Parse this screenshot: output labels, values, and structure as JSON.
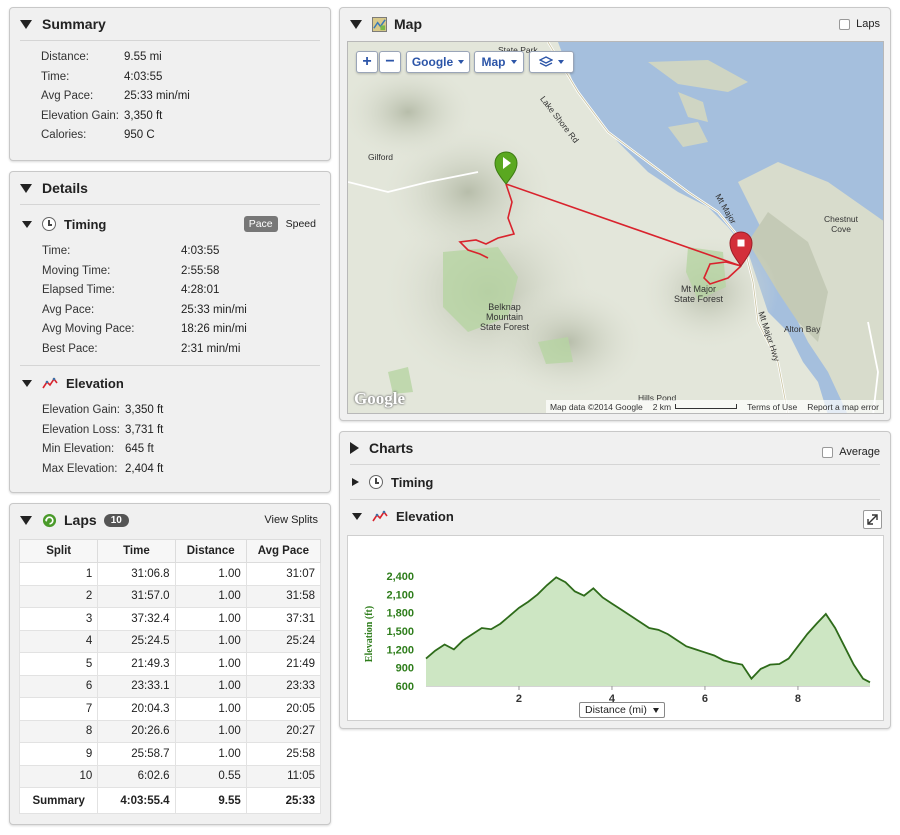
{
  "summary": {
    "title": "Summary",
    "rows": [
      {
        "label": "Distance:",
        "value": "9.55 mi"
      },
      {
        "label": "Time:",
        "value": "4:03:55"
      },
      {
        "label": "Avg Pace:",
        "value": "25:33 min/mi"
      },
      {
        "label": "Elevation Gain:",
        "value": "3,350 ft"
      },
      {
        "label": "Calories:",
        "value": "950 C"
      }
    ]
  },
  "details": {
    "title": "Details",
    "timing": {
      "title": "Timing",
      "toggle_on": "Pace",
      "toggle_off": "Speed",
      "rows": [
        {
          "label": "Time:",
          "value": "4:03:55"
        },
        {
          "label": "Moving Time:",
          "value": "2:55:58"
        },
        {
          "label": "Elapsed Time:",
          "value": "4:28:01"
        },
        {
          "label": "Avg Pace:",
          "value": "25:33 min/mi"
        },
        {
          "label": "Avg Moving Pace:",
          "value": "18:26 min/mi"
        },
        {
          "label": "Best Pace:",
          "value": "2:31 min/mi"
        }
      ]
    },
    "elevation": {
      "title": "Elevation",
      "rows": [
        {
          "label": "Elevation Gain:",
          "value": "3,350 ft"
        },
        {
          "label": "Elevation Loss:",
          "value": "3,731 ft"
        },
        {
          "label": "Min Elevation:",
          "value": "645 ft"
        },
        {
          "label": "Max Elevation:",
          "value": "2,404 ft"
        }
      ]
    }
  },
  "laps": {
    "title": "Laps",
    "count": "10",
    "view_splits": "View Splits",
    "columns": [
      "Split",
      "Time",
      "Distance",
      "Avg Pace"
    ],
    "rows": [
      [
        "1",
        "31:06.8",
        "1.00",
        "31:07"
      ],
      [
        "2",
        "31:57.0",
        "1.00",
        "31:58"
      ],
      [
        "3",
        "37:32.4",
        "1.00",
        "37:31"
      ],
      [
        "4",
        "25:24.5",
        "1.00",
        "25:24"
      ],
      [
        "5",
        "21:49.3",
        "1.00",
        "21:49"
      ],
      [
        "6",
        "23:33.1",
        "1.00",
        "23:33"
      ],
      [
        "7",
        "20:04.3",
        "1.00",
        "20:05"
      ],
      [
        "8",
        "20:26.6",
        "1.00",
        "20:27"
      ],
      [
        "9",
        "25:58.7",
        "1.00",
        "25:58"
      ],
      [
        "10",
        "6:02.6",
        "0.55",
        "11:05"
      ]
    ],
    "summary_row": [
      "Summary",
      "4:03:55.4",
      "9.55",
      "25:33"
    ]
  },
  "map": {
    "title": "Map",
    "laps_label": "Laps",
    "zoom_in": "+",
    "zoom_out": "−",
    "provider_btn": "Google",
    "type_btn": "Map",
    "labels": {
      "state_park": "State Park",
      "lake_shore": "Lake Shore Rd",
      "gilford": "Gilford",
      "mt_major_rd": "Mt Major",
      "chestnut": "Chestnut\nCove",
      "mt_major_sf": "Mt Major\nState Forest",
      "belknap": "Belknap\nMountain\nState Forest",
      "alton_bay": "Alton Bay",
      "mt_major_hwy": "Mt Major Hwy",
      "hills_pond": "Hills Pond"
    },
    "logo": "Google",
    "attribution": "Map data ©2014 Google",
    "scale": "2 km",
    "terms": "Terms of Use",
    "report": "Report a map error",
    "colors": {
      "water": "#a5bfdd",
      "land": "#e3e6da",
      "route": "#d9232d",
      "start": "#5aa820",
      "end": "#d32f3a"
    }
  },
  "charts": {
    "title": "Charts",
    "average_label": "Average",
    "timing_label": "Timing",
    "elevation_label": "Elevation",
    "x_selector": "Distance (mi)"
  },
  "chart_data": {
    "type": "area",
    "ylabel": "Elevation (ft)",
    "xlabel": "Distance (mi)",
    "xlim": [
      0,
      9.55
    ],
    "ylim": [
      600,
      2500
    ],
    "xticks": [
      2,
      4,
      6,
      8
    ],
    "yticks": [
      600,
      900,
      1200,
      1500,
      1800,
      2100,
      2400
    ],
    "ytick_labels": [
      "600",
      "900",
      "1,200",
      "1,500",
      "1,800",
      "2,100",
      "2,400"
    ],
    "x": [
      0,
      0.2,
      0.4,
      0.6,
      0.8,
      1.0,
      1.2,
      1.4,
      1.6,
      1.8,
      2.0,
      2.2,
      2.4,
      2.6,
      2.8,
      3.0,
      3.2,
      3.4,
      3.6,
      3.8,
      4.0,
      4.2,
      4.4,
      4.6,
      4.8,
      5.0,
      5.2,
      5.4,
      5.6,
      5.8,
      6.0,
      6.2,
      6.4,
      6.6,
      6.8,
      7.0,
      7.2,
      7.4,
      7.6,
      7.8,
      8.0,
      8.2,
      8.4,
      8.6,
      8.8,
      9.0,
      9.2,
      9.4,
      9.55
    ],
    "y": [
      1050,
      1180,
      1280,
      1200,
      1350,
      1450,
      1550,
      1530,
      1620,
      1750,
      1880,
      1980,
      2100,
      2250,
      2380,
      2300,
      2150,
      2080,
      2200,
      2050,
      1950,
      1850,
      1750,
      1650,
      1550,
      1520,
      1450,
      1350,
      1250,
      1200,
      1150,
      1100,
      1020,
      980,
      950,
      720,
      880,
      950,
      960,
      1050,
      1250,
      1450,
      1620,
      1780,
      1550,
      1250,
      950,
      720,
      660
    ]
  }
}
